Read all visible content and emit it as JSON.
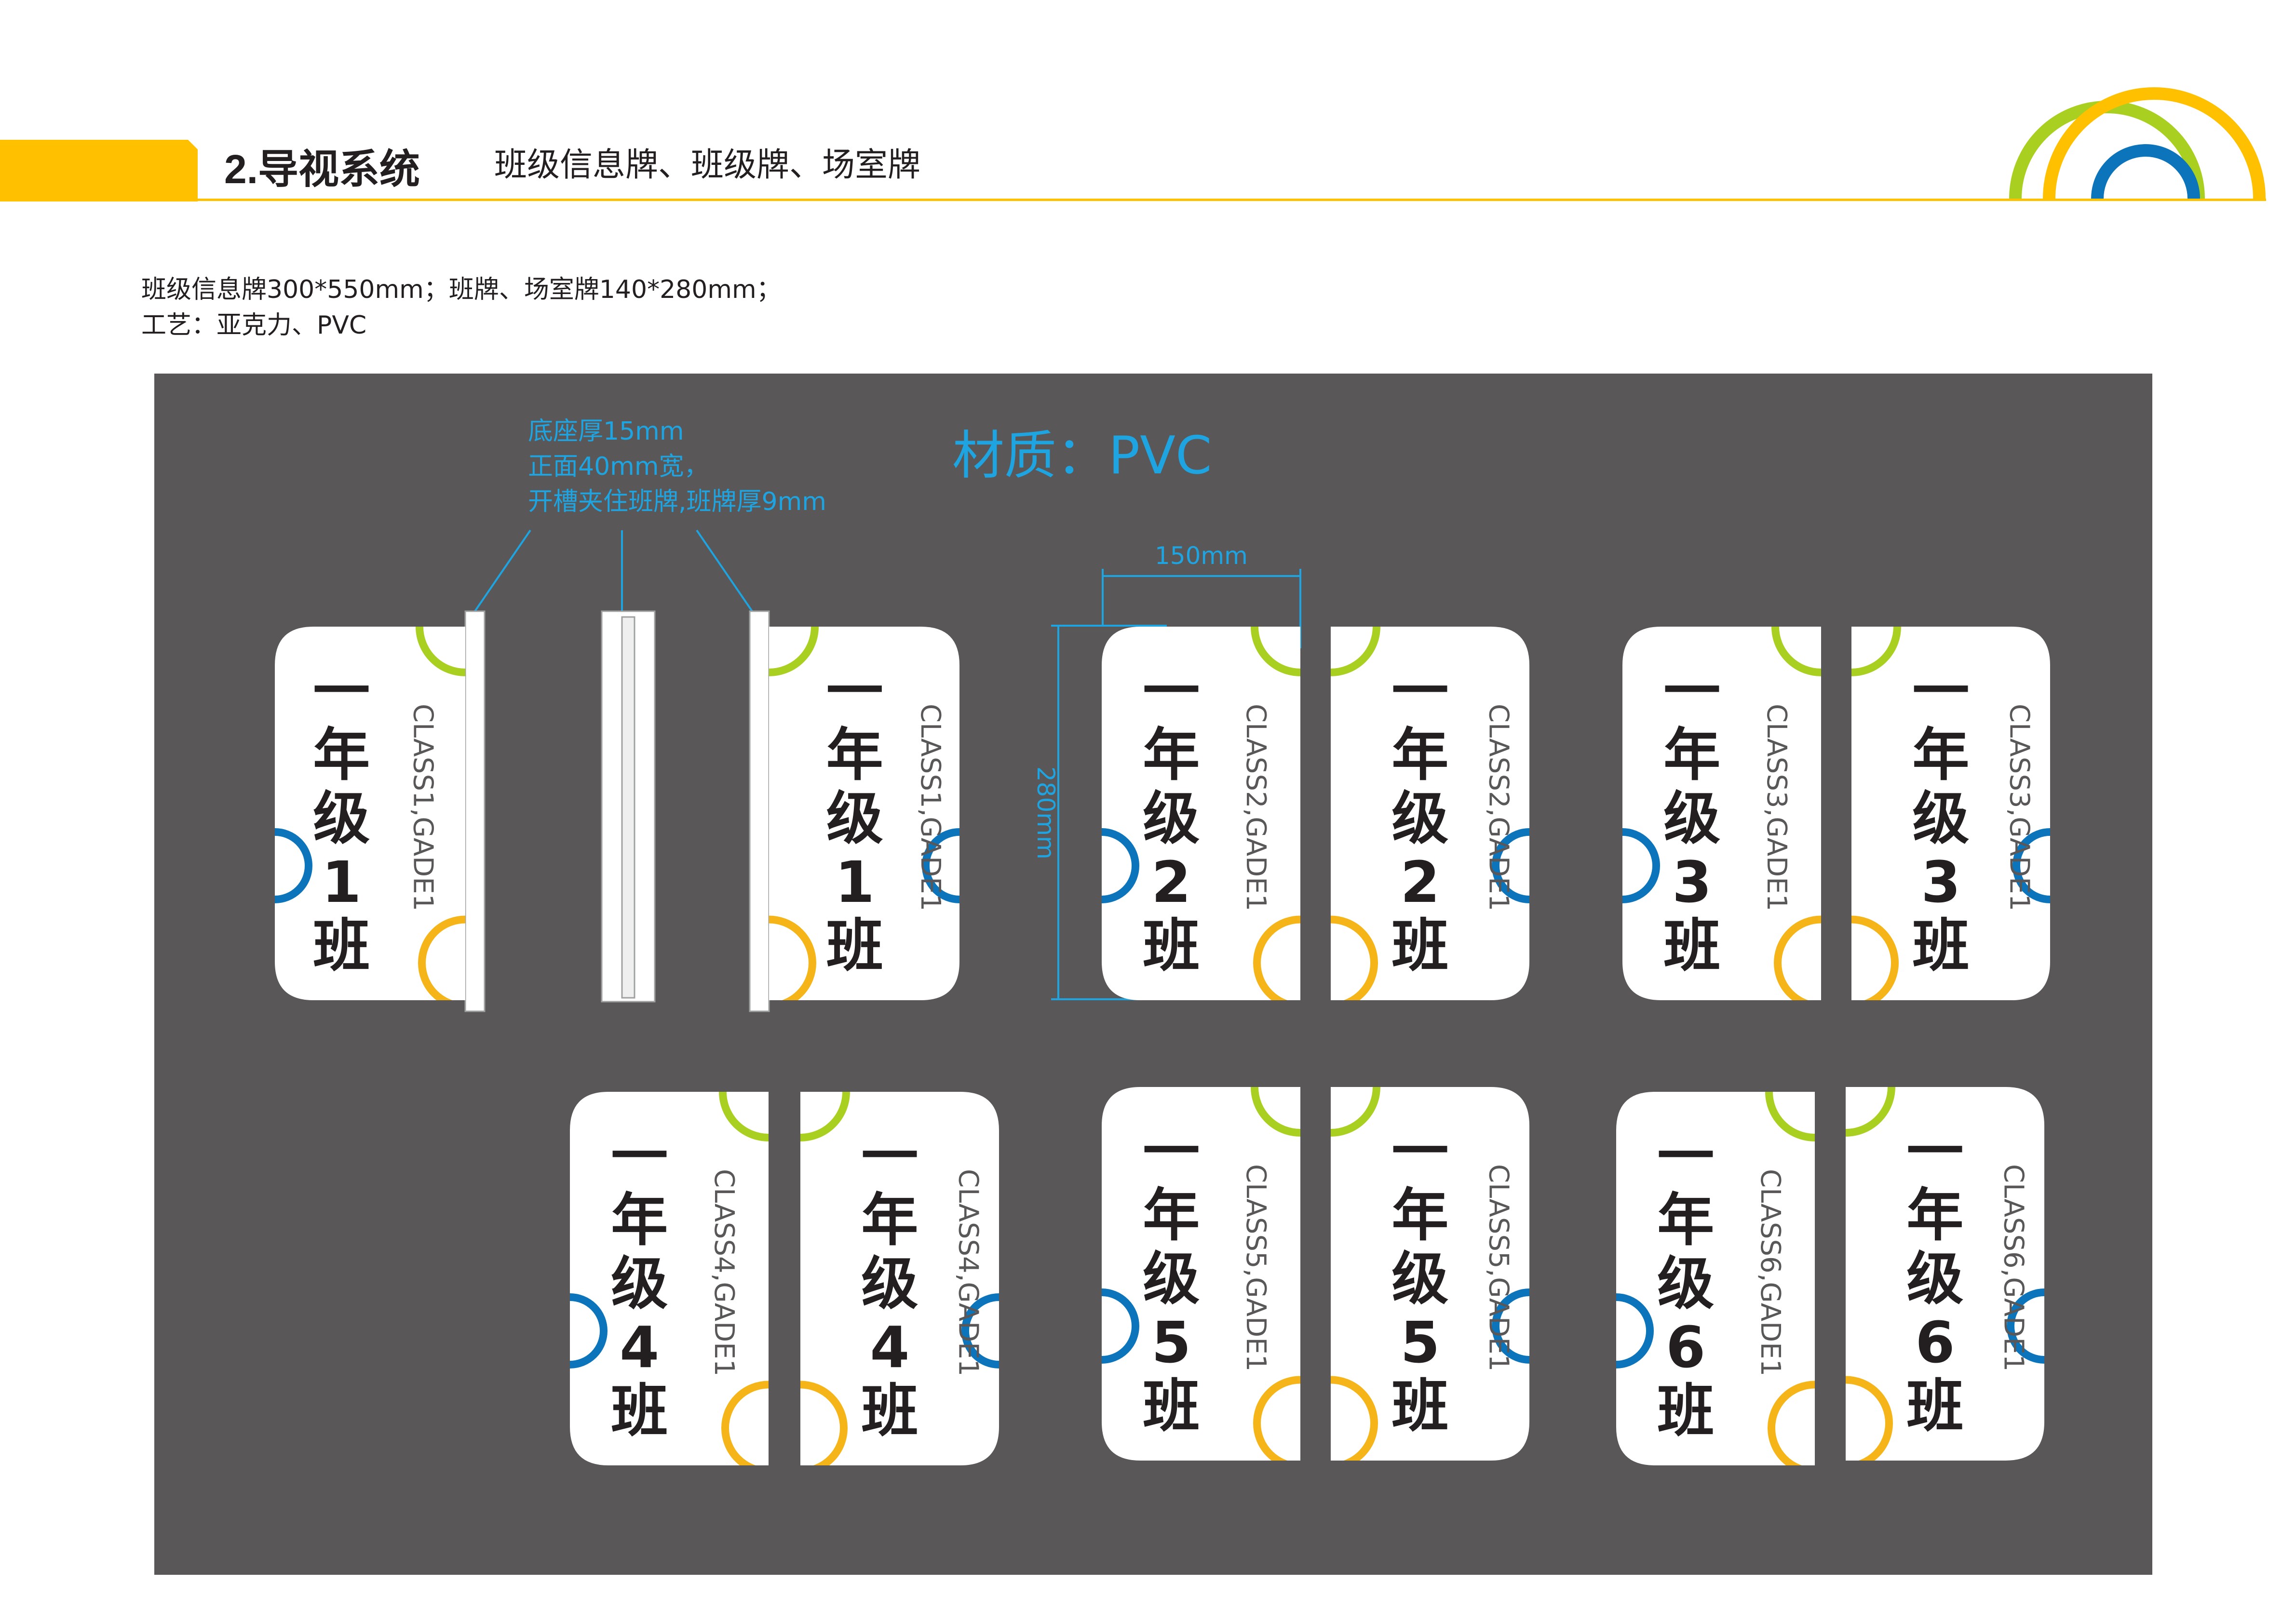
{
  "header": {
    "section_title": "2.导视系统",
    "subtitle": "班级信息牌、班级牌、场室牌"
  },
  "specs": {
    "line1": "班级信息牌300*550mm；班牌、场室牌140*280mm；",
    "line2": "工艺：亚克力、PVC"
  },
  "annotations": {
    "material": "材质：PVC",
    "base_line1": "底座厚15mm",
    "base_line2": "正面40mm宽，",
    "base_line3": "开槽夹住班牌,班牌厚9mm",
    "width_dim": "150mm",
    "height_dim": "280mm"
  },
  "colors": {
    "accent_yellow": "#FFC000",
    "panel_gray": "#595757",
    "arc_green": "#A9CF21",
    "arc_blue": "#0C74BA",
    "arc_orange": "#F5B417",
    "annotation_blue": "#1EA4E1",
    "sign_text": "#231F20",
    "english_text": "#595757"
  },
  "signs": [
    {
      "grade": "一",
      "nian": "年",
      "ji": "级",
      "num": "1",
      "ban": "班",
      "english": "CLASS1,GADE1"
    },
    {
      "grade": "一",
      "nian": "年",
      "ji": "级",
      "num": "1",
      "ban": "班",
      "english": "CLASS1,GADE1"
    },
    {
      "grade": "一",
      "nian": "年",
      "ji": "级",
      "num": "2",
      "ban": "班",
      "english": "CLASS2,GADE1"
    },
    {
      "grade": "一",
      "nian": "年",
      "ji": "级",
      "num": "2",
      "ban": "班",
      "english": "CLASS2,GADE1"
    },
    {
      "grade": "一",
      "nian": "年",
      "ji": "级",
      "num": "3",
      "ban": "班",
      "english": "CLASS3,GADE1"
    },
    {
      "grade": "一",
      "nian": "年",
      "ji": "级",
      "num": "3",
      "ban": "班",
      "english": "CLASS3,GADE1"
    },
    {
      "grade": "一",
      "nian": "年",
      "ji": "级",
      "num": "4",
      "ban": "班",
      "english": "CLASS4,GADE1"
    },
    {
      "grade": "一",
      "nian": "年",
      "ji": "级",
      "num": "4",
      "ban": "班",
      "english": "CLASS4,GADE1"
    },
    {
      "grade": "一",
      "nian": "年",
      "ji": "级",
      "num": "5",
      "ban": "班",
      "english": "CLASS5,GADE1"
    },
    {
      "grade": "一",
      "nian": "年",
      "ji": "级",
      "num": "5",
      "ban": "班",
      "english": "CLASS5,GADE1"
    },
    {
      "grade": "一",
      "nian": "年",
      "ji": "级",
      "num": "6",
      "ban": "班",
      "english": "CLASS6,GADE1"
    },
    {
      "grade": "一",
      "nian": "年",
      "ji": "级",
      "num": "6",
      "ban": "班",
      "english": "CLASS6,GADE1"
    }
  ]
}
